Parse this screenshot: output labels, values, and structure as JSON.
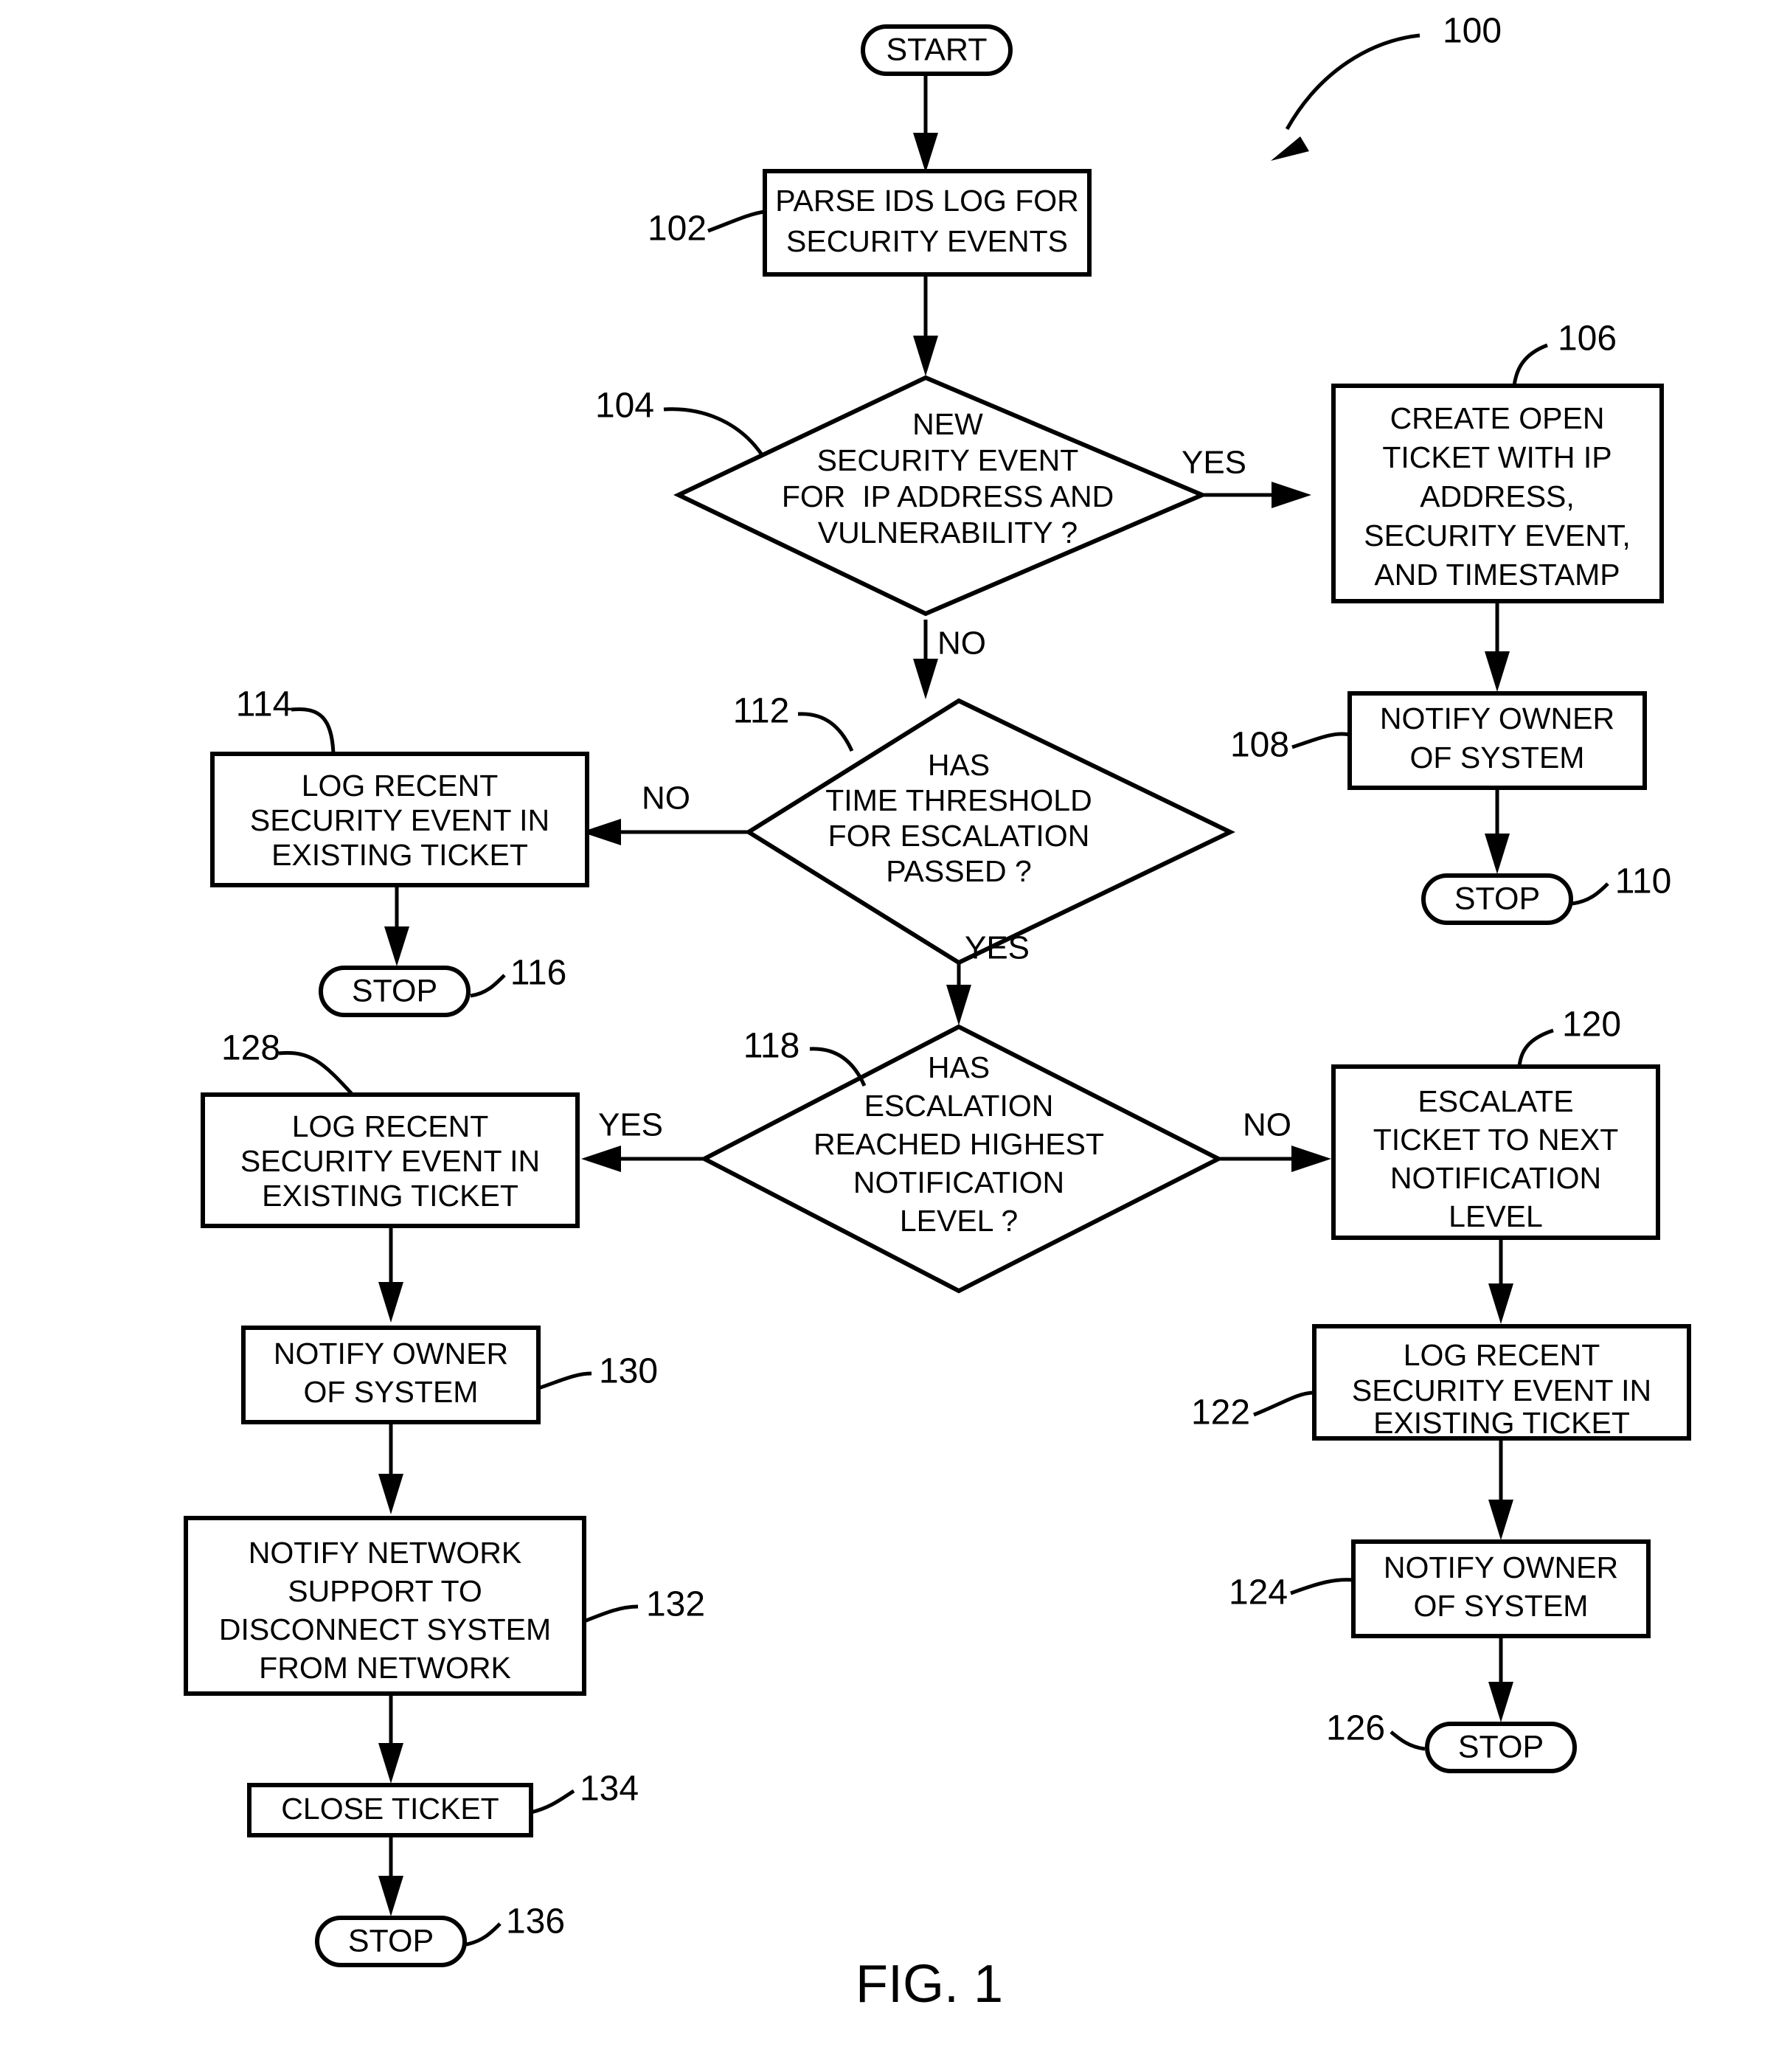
{
  "figure": {
    "caption": "FIG. 1",
    "system_ref": "100"
  },
  "terminals": {
    "start": {
      "label": "START"
    },
    "stop_110": {
      "label": "STOP",
      "ref": "110"
    },
    "stop_116": {
      "label": "STOP",
      "ref": "116"
    },
    "stop_126": {
      "label": "STOP",
      "ref": "126"
    },
    "stop_136": {
      "label": "STOP",
      "ref": "136"
    }
  },
  "nodes": {
    "n102": {
      "ref": "102",
      "lines": [
        "PARSE IDS LOG FOR",
        "SECURITY EVENTS"
      ]
    },
    "n104": {
      "ref": "104",
      "lines": [
        "NEW",
        "SECURITY EVENT",
        "FOR  IP ADDRESS AND",
        "VULNERABILITY ?"
      ]
    },
    "n106": {
      "ref": "106",
      "lines": [
        "CREATE OPEN",
        "TICKET WITH IP",
        "ADDRESS,",
        "SECURITY EVENT,",
        "AND TIMESTAMP"
      ]
    },
    "n108": {
      "ref": "108",
      "lines": [
        "NOTIFY OWNER",
        "OF SYSTEM"
      ]
    },
    "n112": {
      "ref": "112",
      "lines": [
        "HAS",
        "TIME THRESHOLD",
        "FOR ESCALATION",
        "PASSED ?"
      ]
    },
    "n114": {
      "ref": "114",
      "lines": [
        "LOG RECENT",
        "SECURITY EVENT IN",
        "EXISTING TICKET"
      ]
    },
    "n118": {
      "ref": "118",
      "lines": [
        "HAS",
        "ESCALATION",
        "REACHED HIGHEST",
        "NOTIFICATION",
        "LEVEL ?"
      ]
    },
    "n120": {
      "ref": "120",
      "lines": [
        "ESCALATE",
        "TICKET TO NEXT",
        "NOTIFICATION",
        "LEVEL"
      ]
    },
    "n122": {
      "ref": "122",
      "lines": [
        "LOG RECENT",
        "SECURITY EVENT IN",
        "EXISTING TICKET"
      ]
    },
    "n124": {
      "ref": "124",
      "lines": [
        "NOTIFY OWNER",
        "OF SYSTEM"
      ]
    },
    "n128": {
      "ref": "128",
      "lines": [
        "LOG RECENT",
        "SECURITY EVENT IN",
        "EXISTING TICKET"
      ]
    },
    "n130": {
      "ref": "130",
      "lines": [
        "NOTIFY OWNER",
        "OF SYSTEM"
      ]
    },
    "n132": {
      "ref": "132",
      "lines": [
        "NOTIFY NETWORK",
        "SUPPORT TO",
        "DISCONNECT SYSTEM",
        "FROM NETWORK"
      ]
    },
    "n134": {
      "ref": "134",
      "lines": [
        "CLOSE TICKET"
      ]
    }
  },
  "edge_labels": {
    "e104_yes": "YES",
    "e104_no": "NO",
    "e112_no": "NO",
    "e112_yes": "YES",
    "e118_yes": "YES",
    "e118_no": "NO"
  },
  "colors": {
    "stroke": "#000000",
    "fill": "#ffffff",
    "background": "#ffffff"
  }
}
